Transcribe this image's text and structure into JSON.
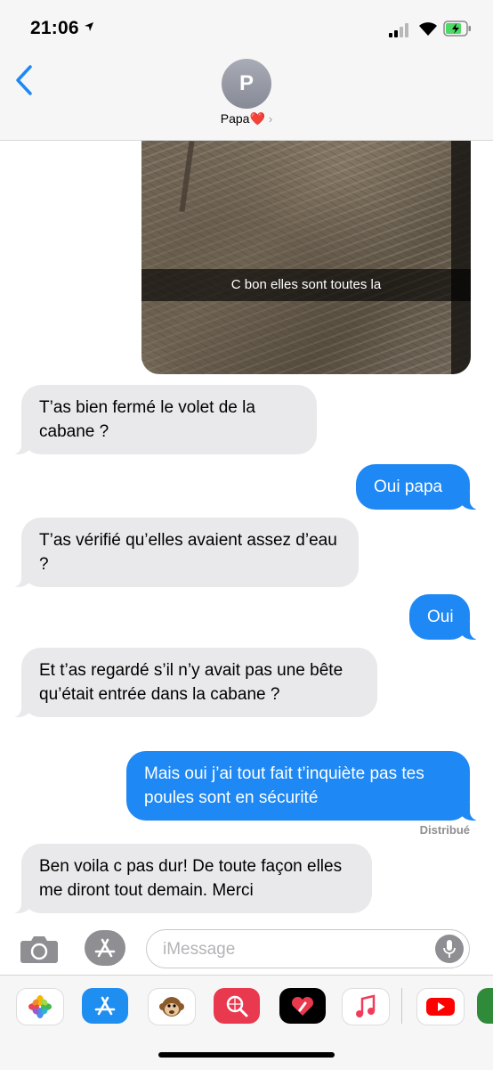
{
  "status_bar": {
    "time": "21:06"
  },
  "nav": {
    "avatar_initial": "P",
    "contact_name": "Papa",
    "heart": "❤️",
    "chevron": "›"
  },
  "photo": {
    "caption": "C bon elles sont toutes la"
  },
  "messages": [
    {
      "direction": "incoming",
      "text": "T’as bien fermé le volet de la cabane ?"
    },
    {
      "direction": "outgoing",
      "text": "Oui papa"
    },
    {
      "direction": "incoming",
      "text": "T’as vérifié qu’elles avaient assez d’eau ?"
    },
    {
      "direction": "outgoing",
      "text": "Oui"
    },
    {
      "direction": "incoming",
      "text": "Et t’as regardé s’il n’y avait pas une bête qu’était entrée dans la cabane ?"
    },
    {
      "direction": "outgoing",
      "text": "Mais oui j’ai tout fait t’inquiète pas tes poules sont en sécurité"
    },
    {
      "direction": "incoming",
      "text": "Ben voila c pas dur! De toute façon elles me diront tout demain. Merci"
    }
  ],
  "delivery_status": "Distribué",
  "composer": {
    "placeholder": "iMessage"
  },
  "app_drawer": [
    "photos-app",
    "app-store-app",
    "animoji-app",
    "web-search-app",
    "digital-touch-app",
    "music-app",
    "youtube-app",
    "extra-app"
  ],
  "colors": {
    "outgoing_bubble": "#1e88f5",
    "incoming_bubble": "#e9e9eb",
    "accent": "#1e88f5"
  }
}
